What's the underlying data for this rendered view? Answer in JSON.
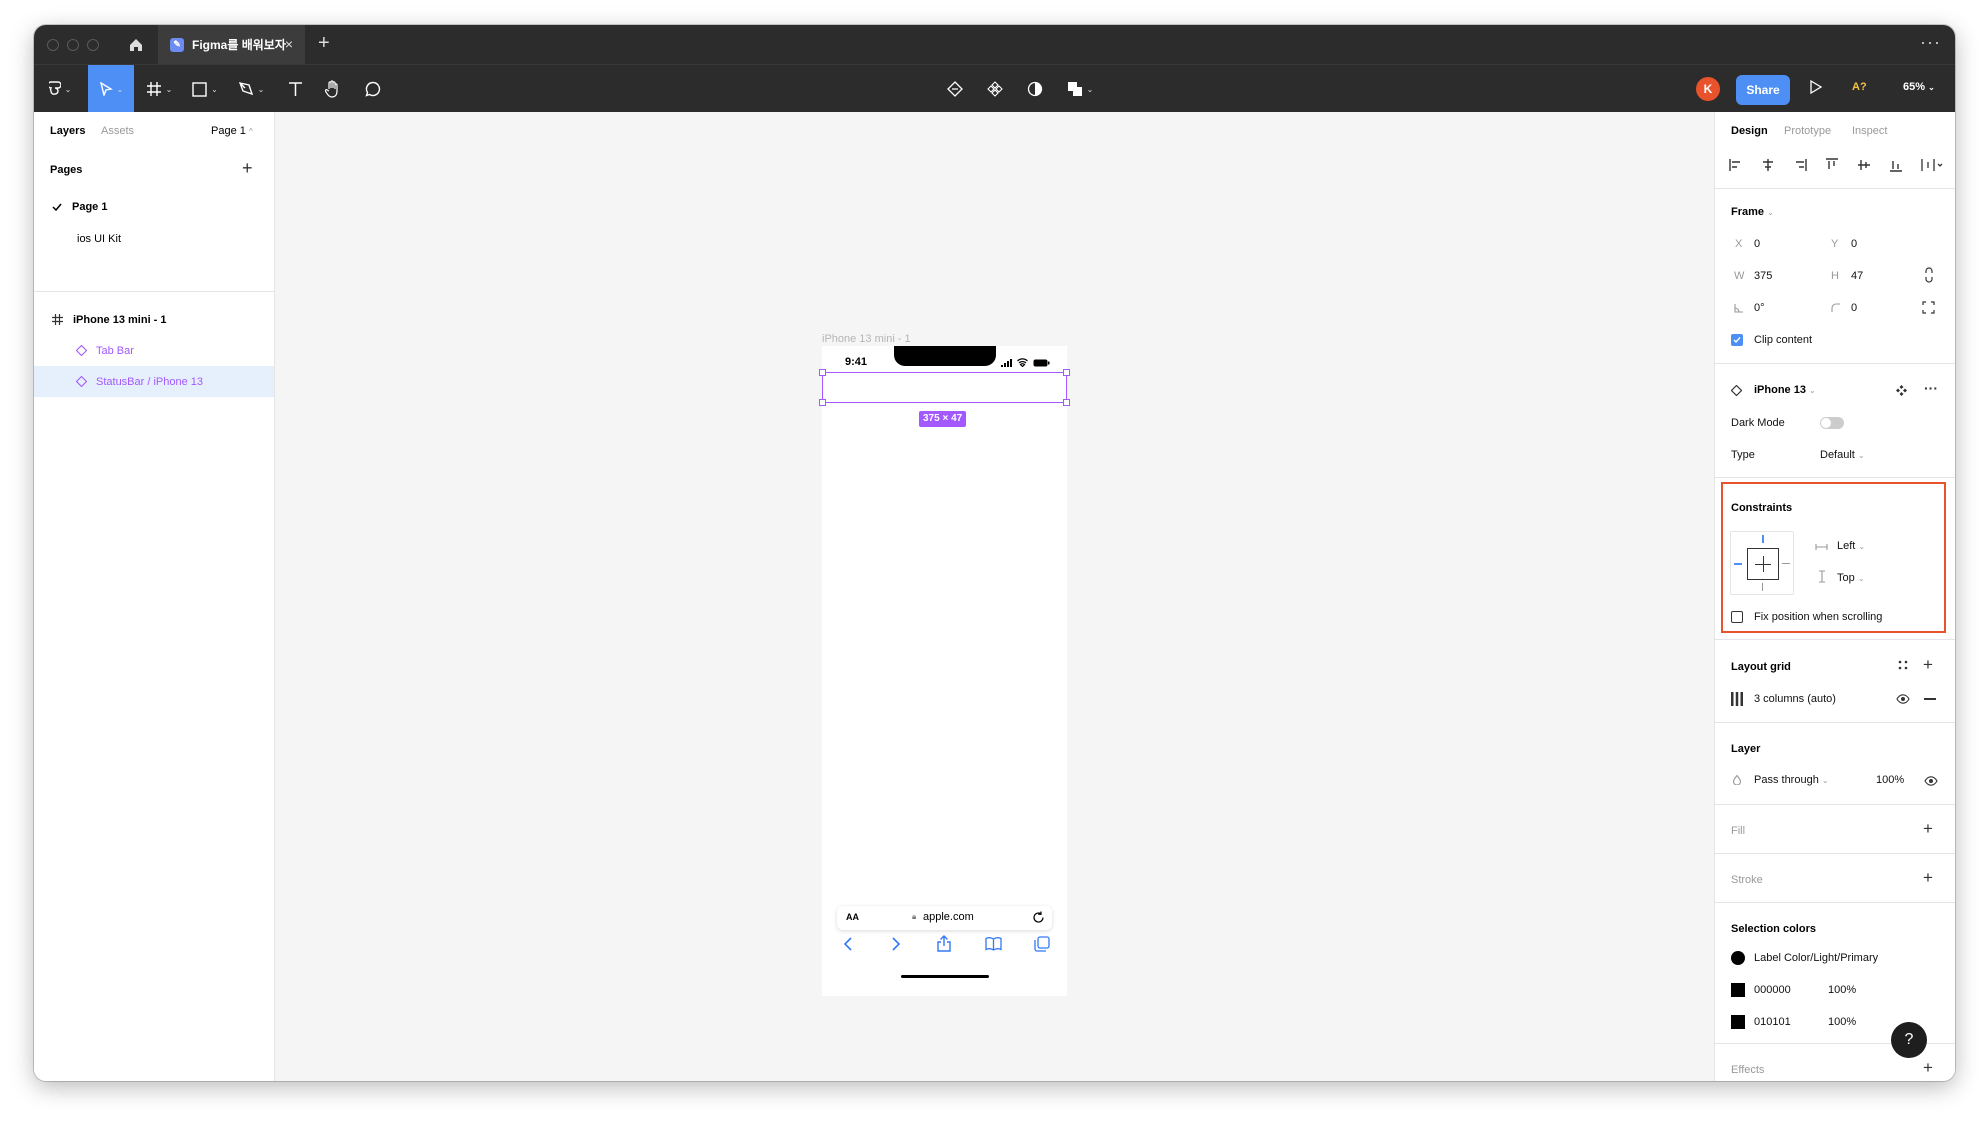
{
  "browser": {
    "tab_title": "Figma를 배워보자",
    "tab_close": "×",
    "new_tab": "+",
    "more": "···"
  },
  "toolbar": {
    "avatar_initial": "K",
    "share_label": "Share",
    "a11y_label": "A?",
    "zoom_label": "65%"
  },
  "left_panel": {
    "tabs": [
      "Layers",
      "Assets"
    ],
    "page_selector": "Page 1",
    "pages_header": "Pages",
    "pages": [
      {
        "name": "Page 1",
        "current": true
      },
      {
        "name": "ios UI Kit",
        "current": false
      }
    ],
    "layers": [
      {
        "name": "iPhone 13 mini - 1",
        "type": "frame",
        "selected": false
      },
      {
        "name": "Tab Bar",
        "type": "instance",
        "selected": false
      },
      {
        "name": "StatusBar / iPhone 13",
        "type": "instance",
        "selected": true
      }
    ]
  },
  "canvas": {
    "frame_label": "iPhone 13 mini - 1",
    "status_time": "9:41",
    "size_badge": "375 × 47",
    "text_size": "AA",
    "url": "apple.com"
  },
  "right_panel": {
    "tabs": [
      "Design",
      "Prototype",
      "Inspect"
    ],
    "frame": {
      "header": "Frame",
      "x_label": "X",
      "x": "0",
      "y_label": "Y",
      "y": "0",
      "w_label": "W",
      "w": "375",
      "h_label": "H",
      "h": "47",
      "rotation": "0°",
      "radius": "0",
      "clip_content": "Clip content"
    },
    "component": {
      "name": "iPhone 13",
      "dark_mode_label": "Dark Mode",
      "type_label": "Type",
      "type_value": "Default"
    },
    "constraints": {
      "header": "Constraints",
      "horizontal": "Left",
      "vertical": "Top",
      "fix_position": "Fix position when scrolling"
    },
    "layout_grid": {
      "header": "Layout grid",
      "item": "3 columns (auto)"
    },
    "layer": {
      "header": "Layer",
      "blend": "Pass through",
      "opacity": "100%"
    },
    "fill": {
      "header": "Fill"
    },
    "stroke": {
      "header": "Stroke"
    },
    "selection_colors": {
      "header": "Selection colors",
      "items": [
        {
          "label": "Label Color/Light/Primary",
          "opacity": ""
        },
        {
          "label": "000000",
          "opacity": "100%"
        },
        {
          "label": "010101",
          "opacity": "100%"
        }
      ]
    },
    "effects": {
      "header": "Effects"
    }
  },
  "help_label": "?",
  "colors": {
    "selection": "#a259ff",
    "accent": "#4d8ff5",
    "highlight_box": "#e8532b",
    "toolbar_bg": "#2c2c2c"
  }
}
